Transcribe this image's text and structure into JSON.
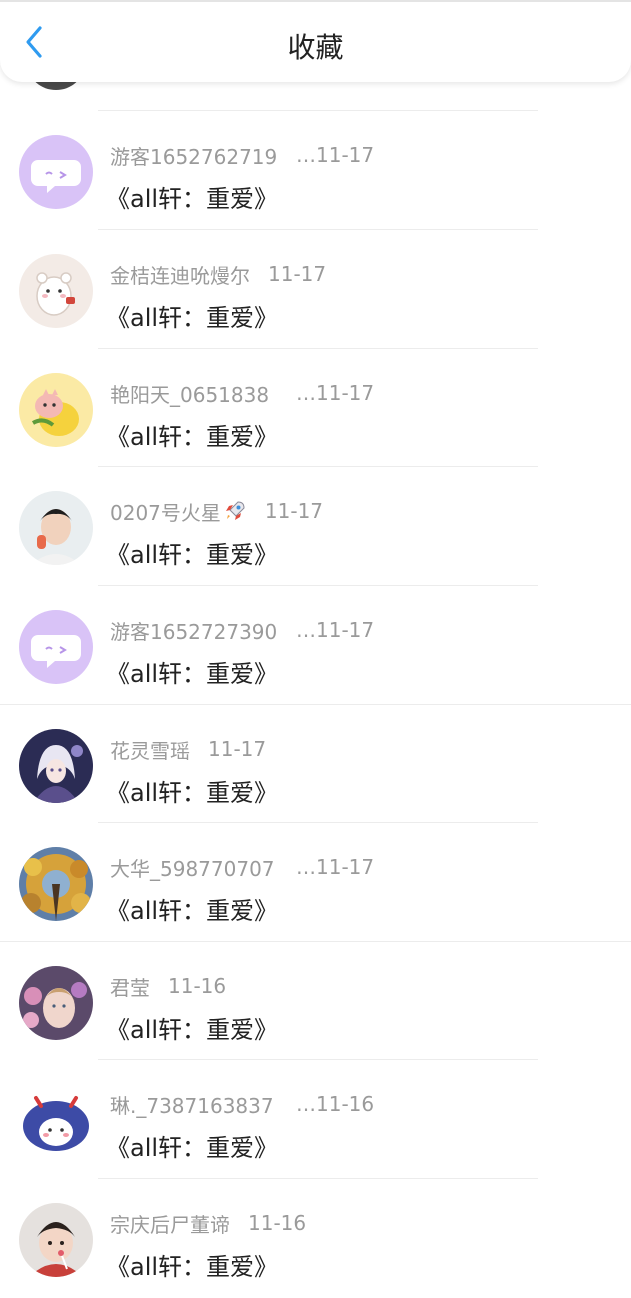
{
  "header": {
    "title": "收藏"
  },
  "items": [
    {
      "name": "游客1652762719",
      "date": "11-17",
      "title": "《all轩：重爱》"
    },
    {
      "name": "金桔连迪吮熳尔",
      "date": "11-17",
      "title": "《all轩：重爱》"
    },
    {
      "name": "艳阳天_0651838",
      "date": "11-17",
      "title": "《all轩：重爱》"
    },
    {
      "name": "0207号火星",
      "date": "11-17",
      "title": "《all轩：重爱》"
    },
    {
      "name": "游客1652727390",
      "date": "11-17",
      "title": "《all轩：重爱》"
    },
    {
      "name": "花灵雪瑶",
      "date": "11-17",
      "title": "《all轩：重爱》"
    },
    {
      "name": "大华_598770707",
      "date": "11-17",
      "title": "《all轩：重爱》"
    },
    {
      "name": "君莹",
      "date": "11-16",
      "title": "《all轩：重爱》"
    },
    {
      "name": "琳._7387163837",
      "date": "11-16",
      "title": "《all轩：重爱》"
    },
    {
      "name": "宗庆后尸董谛",
      "date": "11-16",
      "title": "《all轩：重爱》"
    }
  ],
  "icons": {
    "back": "chevron-left-icon",
    "rocket": "rocket-icon"
  },
  "colors": {
    "accent": "#2f9bf0",
    "text_primary": "#222222",
    "text_secondary": "#9a9a9a",
    "guest_avatar": "#d6bdf5"
  }
}
